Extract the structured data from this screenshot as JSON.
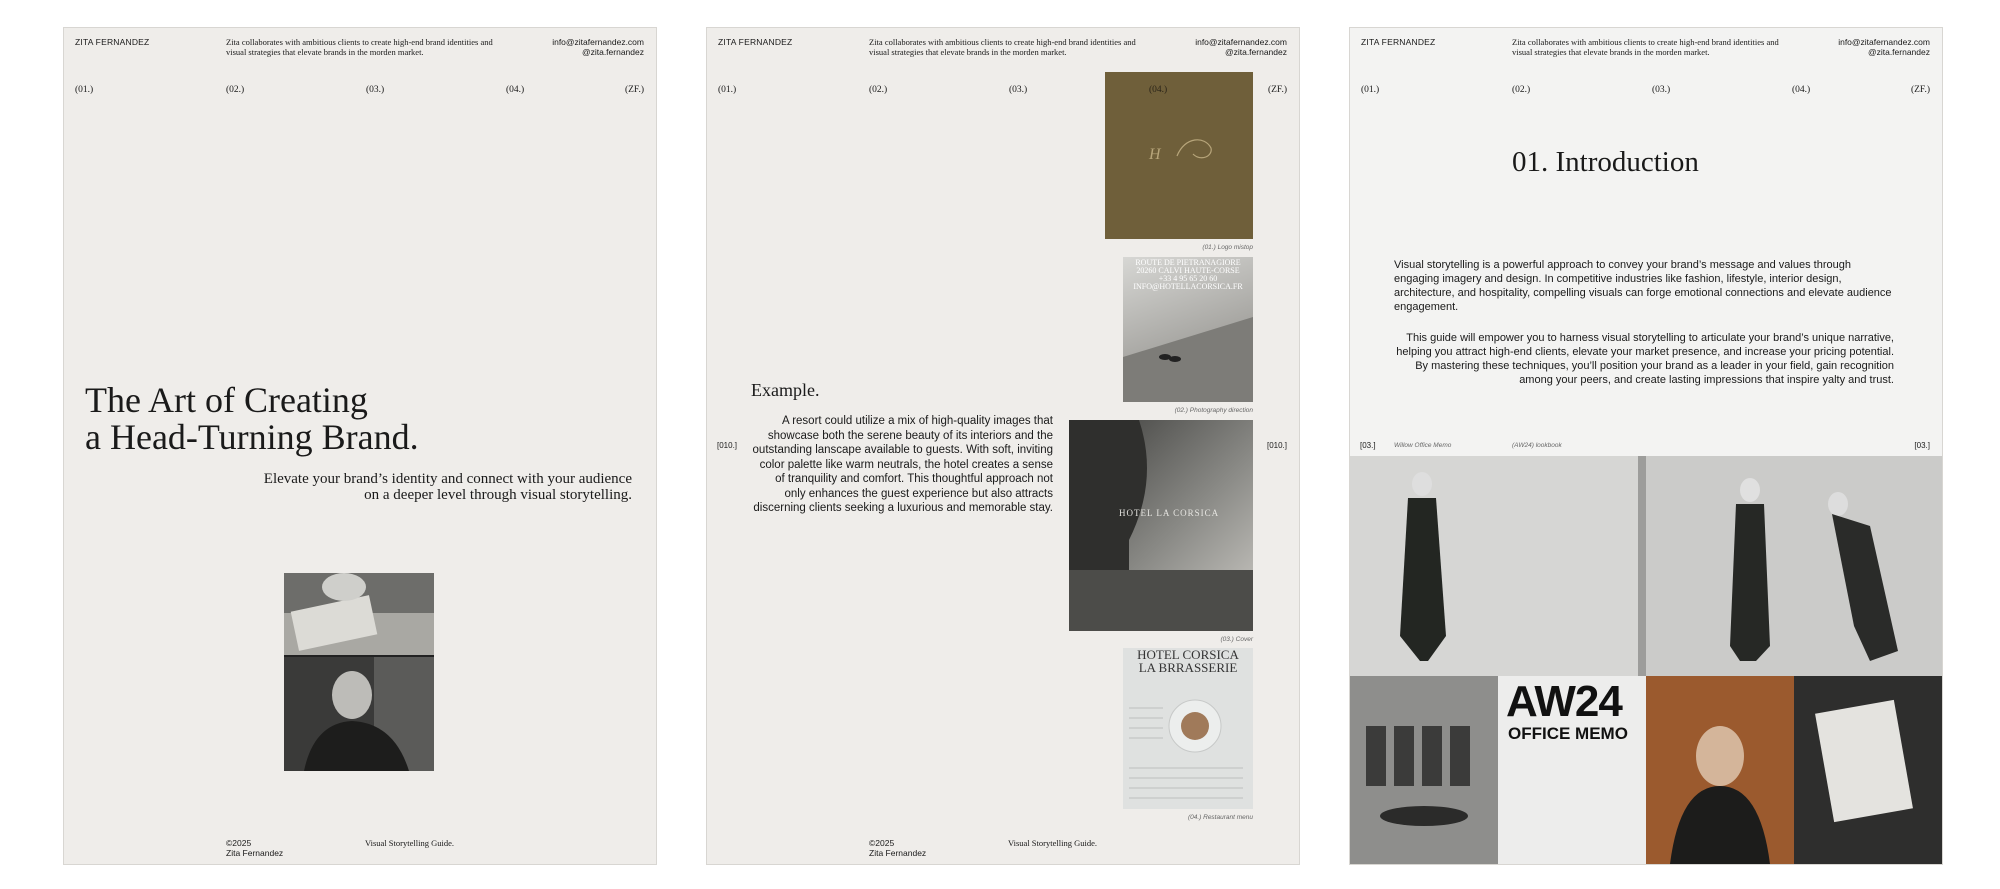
{
  "common": {
    "brand": "ZITA FERNANDEZ",
    "tagline": "Zita collaborates with ambitious clients to create high-end brand identities and visual strategies that elevate brands in the morden market.",
    "email": "info@zitafernandez.com",
    "handle": "@zita.fernandez",
    "nav": [
      "(01.)",
      "(02.)",
      "(03.)",
      "(04.)",
      "(ZF.)"
    ],
    "copyright": "©2025",
    "author": "Zita Fernandez",
    "guide": "Visual Storytelling Guide."
  },
  "page1": {
    "title_line1": "The Art of Creating",
    "title_line2": "a Head-Turning Brand.",
    "subtitle_line1": "Elevate your brand’s identity and connect with your audience",
    "subtitle_line2": "on a deeper level through visual storytelling."
  },
  "page2": {
    "side_label": "[010.]",
    "heading": "Example.",
    "body": "A resort could utilize a mix of high-quality images that showcase both the serene beauty of its interiors and the outstanding lanscape available to guests. With soft, inviting color palette like warm neutrals, the hotel creates a sense of tranquility and comfort. This thoughtful approach not only enhances the guest experience but also attracts discerning clients seeking a luxurious and memorable stay.",
    "captions": [
      "(01.) Logo mistop",
      "(02.) Photography direction",
      "(03.) Cover",
      "(04.) Restaurant menu"
    ],
    "logo_mark": "H",
    "photo_text_lines": [
      "ROUTE DE PIETRANAGIORE",
      "20260 CALVI HAUTE-CORSE",
      "+33 4 95 65 20 60",
      "INFO@HOTELLACORSICA.FR"
    ],
    "cover_text": "HOTEL LA CORSICA",
    "menu_title1": "HOTEL CORSICA",
    "menu_title2": "LA BRRASSERIE"
  },
  "page3": {
    "title": "01. Introduction",
    "para1": "Visual storytelling is a powerful approach to convey your brand’s message and values through engaging imagery and design. In competitive industries like fashion, lifestyle, interior design, architecture, and hospitality, compelling visuals can forge emotional connections and elevate audience engagement.",
    "para2": "This guide will empower you to harness visual storytelling to articulate your brand’s unique narrative, helping you attract high-end clients, elevate your market presence, and increase your pricing potential. By mastering these techniques, you’ll position your brand as a leader in your field, gain recognition among your peers, and create lasting impressions that inspire yalty and trust.",
    "side_label": "[03.]",
    "label_a": "Willow Office Memo",
    "label_b": "(AW24) lookbook",
    "aw": "AW24",
    "memo": "OFFICE MEMO"
  }
}
